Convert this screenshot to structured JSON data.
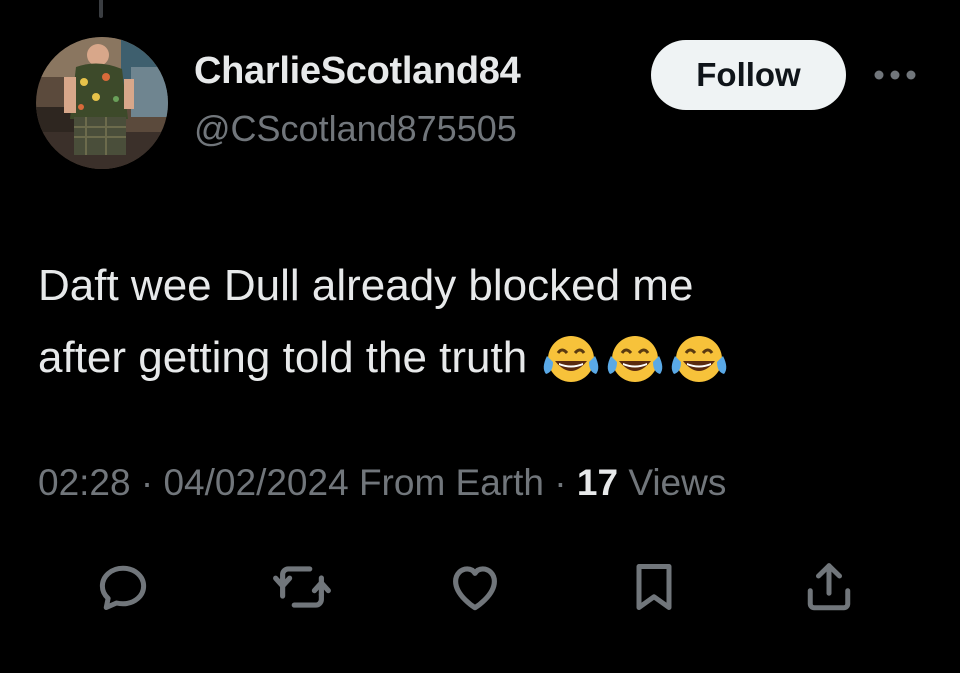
{
  "tweet": {
    "author": {
      "display_name": "CharlieScotland84",
      "handle": "@CScotland875505"
    },
    "follow_label": "Follow",
    "text_line_1": "Daft wee Dull already blocked me",
    "text_line_2": "after getting told the truth",
    "emoji": "😂",
    "meta": {
      "time": "02:28",
      "separator": "·",
      "date": "04/02/2024",
      "location": "From Earth",
      "views_count": "17",
      "views_label": "Views"
    }
  },
  "actions": [
    {
      "icon": "reply-icon"
    },
    {
      "icon": "retweet-icon"
    },
    {
      "icon": "like-icon"
    },
    {
      "icon": "bookmark-icon"
    },
    {
      "icon": "share-icon"
    }
  ],
  "colors": {
    "background": "#000000",
    "primary_text": "#e7e9ea",
    "secondary_text": "#71767b",
    "follow_button_bg": "#eff3f4",
    "follow_button_text": "#0f1419"
  }
}
